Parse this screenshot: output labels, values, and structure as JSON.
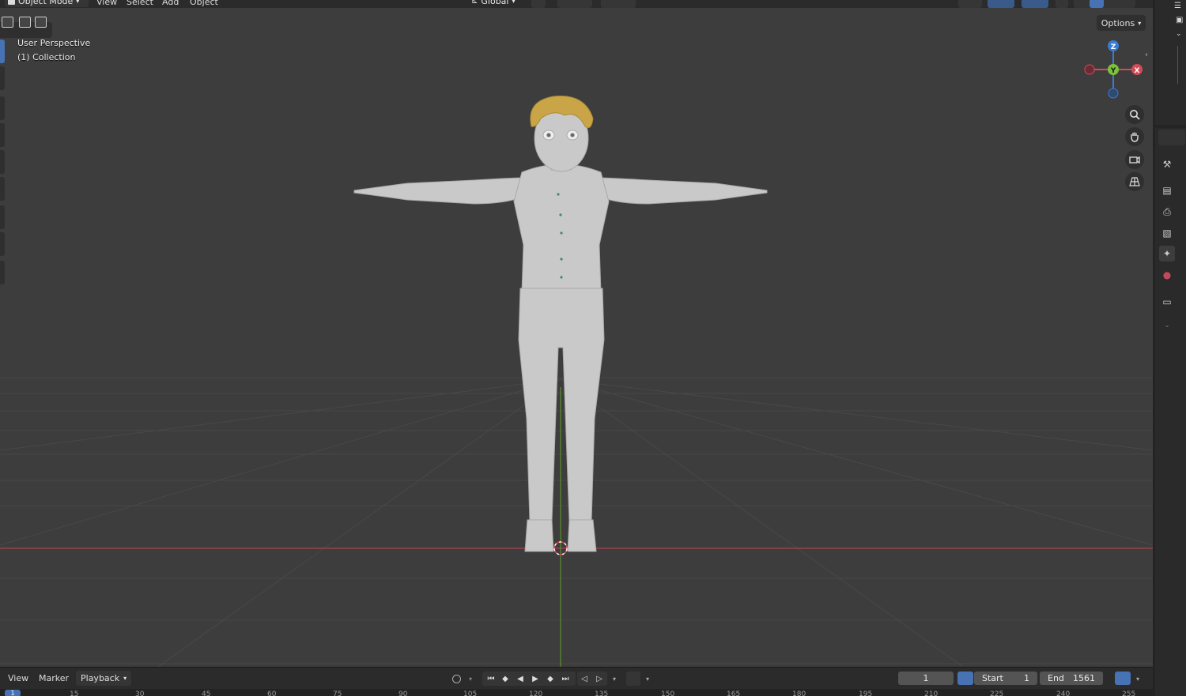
{
  "header": {
    "mode_label": "Object Mode",
    "menus": [
      "View",
      "Select",
      "Add",
      "Object"
    ],
    "transform_orientation": "Global"
  },
  "viewport": {
    "view_name": "User Perspective",
    "collection": "(1) Collection",
    "options_label": "Options",
    "gizmo_axes": {
      "z": "Z",
      "y": "Y",
      "x": "X"
    }
  },
  "timeline": {
    "menus": [
      "View",
      "Marker"
    ],
    "playback_label": "Playback",
    "current_frame": "1",
    "start_label": "Start",
    "start_value": "1",
    "end_label": "End",
    "end_value": "1561",
    "ruler_current": "1",
    "ruler_ticks": [
      "15",
      "30",
      "45",
      "60",
      "75",
      "90",
      "105",
      "120",
      "135",
      "150",
      "165",
      "180",
      "195",
      "210",
      "225",
      "240",
      "255"
    ]
  },
  "colors": {
    "x_axis": "#d44a57",
    "y_axis": "#7cc23a",
    "z_axis": "#3a7bd4",
    "active_blue": "#4772b3"
  }
}
